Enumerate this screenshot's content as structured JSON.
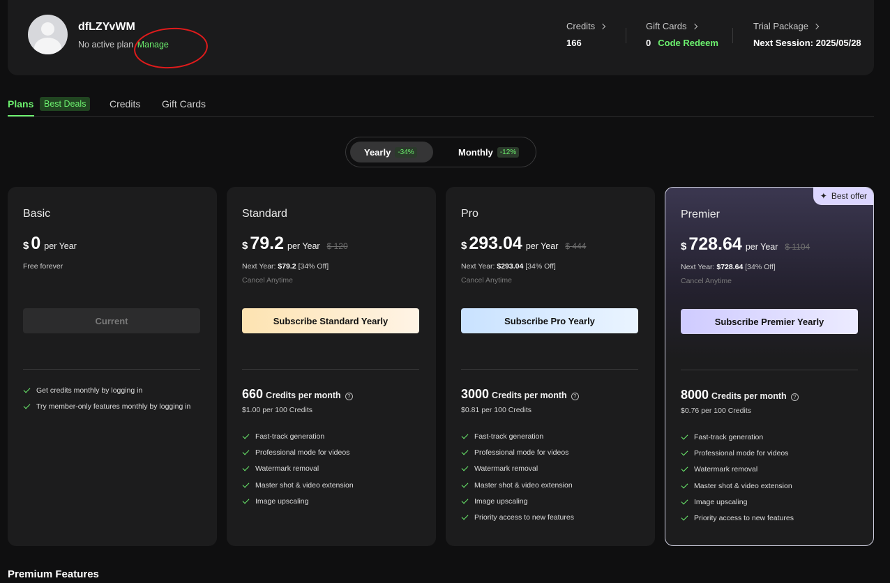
{
  "profile": {
    "username": "dfLZYvWM",
    "plan_status": "No active plan",
    "manage_label": "Manage",
    "annotation_color": "#e01b1b"
  },
  "stats": {
    "credits": {
      "label": "Credits",
      "value": "166"
    },
    "gift_cards": {
      "label": "Gift Cards",
      "value": "0",
      "redeem_label": "Code Redeem"
    },
    "trial": {
      "label": "Trial Package",
      "value": "Next Session: 2025/05/28"
    }
  },
  "tabs": [
    {
      "label": "Plans",
      "badge": "Best Deals",
      "active": true
    },
    {
      "label": "Credits"
    },
    {
      "label": "Gift Cards"
    }
  ],
  "billing_toggle": {
    "yearly": {
      "label": "Yearly",
      "discount": "-34%"
    },
    "monthly": {
      "label": "Monthly",
      "discount": "-12%"
    }
  },
  "plans": [
    {
      "name": "Basic",
      "currency": "$",
      "price": "0",
      "period": "per Year",
      "note": "Free forever",
      "cta": "Current",
      "features": [
        "Get credits monthly by logging in",
        "Try member-only features monthly by logging in"
      ]
    },
    {
      "name": "Standard",
      "currency": "$",
      "price": "79.2",
      "period": "per Year",
      "original": "$ 120",
      "next_year_label": "Next Year:",
      "next_year_price": "$79.2",
      "next_year_off": "[34% Off]",
      "cancel": "Cancel Anytime",
      "cta": "Subscribe Standard Yearly",
      "credits": "660",
      "credits_label": "Credits per month",
      "per_100": "$1.00 per 100 Credits",
      "features": [
        "Fast-track generation",
        "Professional mode for videos",
        "Watermark removal",
        "Master shot & video extension",
        "Image upscaling"
      ]
    },
    {
      "name": "Pro",
      "currency": "$",
      "price": "293.04",
      "period": "per Year",
      "original": "$ 444",
      "next_year_label": "Next Year:",
      "next_year_price": "$293.04",
      "next_year_off": "[34% Off]",
      "cancel": "Cancel Anytime",
      "cta": "Subscribe Pro Yearly",
      "credits": "3000",
      "credits_label": "Credits per month",
      "per_100": "$0.81 per 100 Credits",
      "features": [
        "Fast-track generation",
        "Professional mode for videos",
        "Watermark removal",
        "Master shot & video extension",
        "Image upscaling",
        "Priority access to new features"
      ]
    },
    {
      "name": "Premier",
      "currency": "$",
      "price": "728.64",
      "period": "per Year",
      "original": "$ 1104",
      "next_year_label": "Next Year:",
      "next_year_price": "$728.64",
      "next_year_off": "[34% Off]",
      "cancel": "Cancel Anytime",
      "cta": "Subscribe Premier Yearly",
      "credits": "8000",
      "credits_label": "Credits per month",
      "per_100": "$0.76 per 100 Credits",
      "badge": "Best offer",
      "features": [
        "Fast-track generation",
        "Professional mode for videos",
        "Watermark removal",
        "Master shot & video extension",
        "Image upscaling",
        "Priority access to new features"
      ]
    }
  ],
  "help_glyph": "?",
  "sparkle_glyph": "✦",
  "section_title": "Premium Features",
  "colors": {
    "accent": "#6cf06e",
    "background": "#0f0f10",
    "card": "#1c1c1d"
  }
}
